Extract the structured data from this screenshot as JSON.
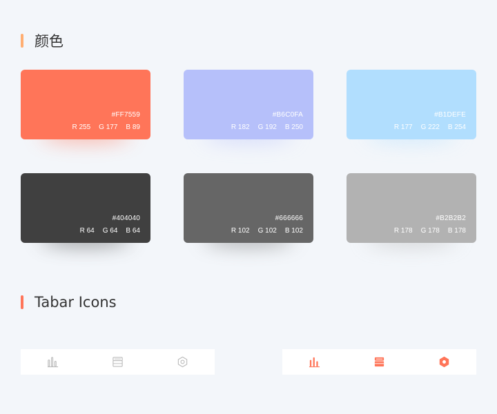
{
  "sections": {
    "colors": {
      "title": "颜色",
      "accent": "#FFAE72"
    },
    "tabbar": {
      "title": "Tabar Icons",
      "accent": "#FF7559"
    }
  },
  "swatches": [
    {
      "hex": "#FF7559",
      "r": "R 255",
      "g": "G 177",
      "b": "B 89",
      "color": "#FF7559"
    },
    {
      "hex": "#B6C0FA",
      "r": "R 182",
      "g": "G 192",
      "b": "B 250",
      "color": "#B6C0FA"
    },
    {
      "hex": "#B1DEFE",
      "r": "R 177",
      "g": "G 222",
      "b": "B 254",
      "color": "#B1DEFE"
    },
    {
      "hex": "#404040",
      "r": "R 64",
      "g": "G 64",
      "b": "B 64",
      "color": "#404040"
    },
    {
      "hex": "#666666",
      "r": "R 102",
      "g": "G 102",
      "b": "B 102",
      "color": "#666666"
    },
    {
      "hex": "#B2B2B2",
      "r": "R 178",
      "g": "G 178",
      "b": "B 178",
      "color": "#B2B2B2"
    }
  ],
  "tabbars": {
    "inactive": {
      "color": "#BBBBBB",
      "icons": [
        "bar-chart-icon",
        "inbox-icon",
        "gear-icon"
      ]
    },
    "active": {
      "color": "#FF7559",
      "icons": [
        "bar-chart-icon",
        "inbox-icon",
        "gear-icon"
      ]
    }
  }
}
